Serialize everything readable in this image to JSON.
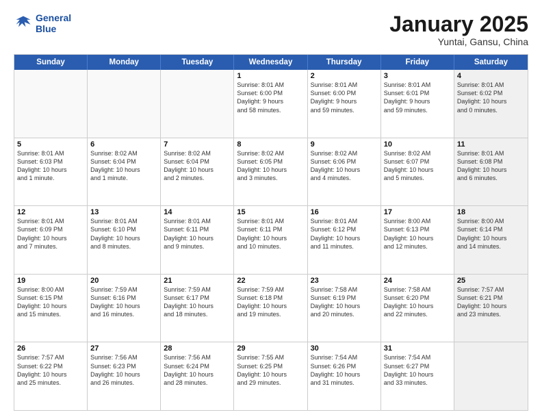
{
  "logo": {
    "line1": "General",
    "line2": "Blue"
  },
  "title": "January 2025",
  "subtitle": "Yuntai, Gansu, China",
  "header_days": [
    "Sunday",
    "Monday",
    "Tuesday",
    "Wednesday",
    "Thursday",
    "Friday",
    "Saturday"
  ],
  "rows": [
    [
      {
        "day": "",
        "info": "",
        "empty": true
      },
      {
        "day": "",
        "info": "",
        "empty": true
      },
      {
        "day": "",
        "info": "",
        "empty": true
      },
      {
        "day": "1",
        "info": "Sunrise: 8:01 AM\nSunset: 6:00 PM\nDaylight: 9 hours\nand 58 minutes."
      },
      {
        "day": "2",
        "info": "Sunrise: 8:01 AM\nSunset: 6:00 PM\nDaylight: 9 hours\nand 59 minutes."
      },
      {
        "day": "3",
        "info": "Sunrise: 8:01 AM\nSunset: 6:01 PM\nDaylight: 9 hours\nand 59 minutes."
      },
      {
        "day": "4",
        "info": "Sunrise: 8:01 AM\nSunset: 6:02 PM\nDaylight: 10 hours\nand 0 minutes.",
        "shaded": true
      }
    ],
    [
      {
        "day": "5",
        "info": "Sunrise: 8:01 AM\nSunset: 6:03 PM\nDaylight: 10 hours\nand 1 minute."
      },
      {
        "day": "6",
        "info": "Sunrise: 8:02 AM\nSunset: 6:04 PM\nDaylight: 10 hours\nand 1 minute."
      },
      {
        "day": "7",
        "info": "Sunrise: 8:02 AM\nSunset: 6:04 PM\nDaylight: 10 hours\nand 2 minutes."
      },
      {
        "day": "8",
        "info": "Sunrise: 8:02 AM\nSunset: 6:05 PM\nDaylight: 10 hours\nand 3 minutes."
      },
      {
        "day": "9",
        "info": "Sunrise: 8:02 AM\nSunset: 6:06 PM\nDaylight: 10 hours\nand 4 minutes."
      },
      {
        "day": "10",
        "info": "Sunrise: 8:02 AM\nSunset: 6:07 PM\nDaylight: 10 hours\nand 5 minutes."
      },
      {
        "day": "11",
        "info": "Sunrise: 8:01 AM\nSunset: 6:08 PM\nDaylight: 10 hours\nand 6 minutes.",
        "shaded": true
      }
    ],
    [
      {
        "day": "12",
        "info": "Sunrise: 8:01 AM\nSunset: 6:09 PM\nDaylight: 10 hours\nand 7 minutes."
      },
      {
        "day": "13",
        "info": "Sunrise: 8:01 AM\nSunset: 6:10 PM\nDaylight: 10 hours\nand 8 minutes."
      },
      {
        "day": "14",
        "info": "Sunrise: 8:01 AM\nSunset: 6:11 PM\nDaylight: 10 hours\nand 9 minutes."
      },
      {
        "day": "15",
        "info": "Sunrise: 8:01 AM\nSunset: 6:11 PM\nDaylight: 10 hours\nand 10 minutes."
      },
      {
        "day": "16",
        "info": "Sunrise: 8:01 AM\nSunset: 6:12 PM\nDaylight: 10 hours\nand 11 minutes."
      },
      {
        "day": "17",
        "info": "Sunrise: 8:00 AM\nSunset: 6:13 PM\nDaylight: 10 hours\nand 12 minutes."
      },
      {
        "day": "18",
        "info": "Sunrise: 8:00 AM\nSunset: 6:14 PM\nDaylight: 10 hours\nand 14 minutes.",
        "shaded": true
      }
    ],
    [
      {
        "day": "19",
        "info": "Sunrise: 8:00 AM\nSunset: 6:15 PM\nDaylight: 10 hours\nand 15 minutes."
      },
      {
        "day": "20",
        "info": "Sunrise: 7:59 AM\nSunset: 6:16 PM\nDaylight: 10 hours\nand 16 minutes."
      },
      {
        "day": "21",
        "info": "Sunrise: 7:59 AM\nSunset: 6:17 PM\nDaylight: 10 hours\nand 18 minutes."
      },
      {
        "day": "22",
        "info": "Sunrise: 7:59 AM\nSunset: 6:18 PM\nDaylight: 10 hours\nand 19 minutes."
      },
      {
        "day": "23",
        "info": "Sunrise: 7:58 AM\nSunset: 6:19 PM\nDaylight: 10 hours\nand 20 minutes."
      },
      {
        "day": "24",
        "info": "Sunrise: 7:58 AM\nSunset: 6:20 PM\nDaylight: 10 hours\nand 22 minutes."
      },
      {
        "day": "25",
        "info": "Sunrise: 7:57 AM\nSunset: 6:21 PM\nDaylight: 10 hours\nand 23 minutes.",
        "shaded": true
      }
    ],
    [
      {
        "day": "26",
        "info": "Sunrise: 7:57 AM\nSunset: 6:22 PM\nDaylight: 10 hours\nand 25 minutes."
      },
      {
        "day": "27",
        "info": "Sunrise: 7:56 AM\nSunset: 6:23 PM\nDaylight: 10 hours\nand 26 minutes."
      },
      {
        "day": "28",
        "info": "Sunrise: 7:56 AM\nSunset: 6:24 PM\nDaylight: 10 hours\nand 28 minutes."
      },
      {
        "day": "29",
        "info": "Sunrise: 7:55 AM\nSunset: 6:25 PM\nDaylight: 10 hours\nand 29 minutes."
      },
      {
        "day": "30",
        "info": "Sunrise: 7:54 AM\nSunset: 6:26 PM\nDaylight: 10 hours\nand 31 minutes."
      },
      {
        "day": "31",
        "info": "Sunrise: 7:54 AM\nSunset: 6:27 PM\nDaylight: 10 hours\nand 33 minutes."
      },
      {
        "day": "",
        "info": "",
        "empty": true,
        "shaded": true
      }
    ]
  ]
}
